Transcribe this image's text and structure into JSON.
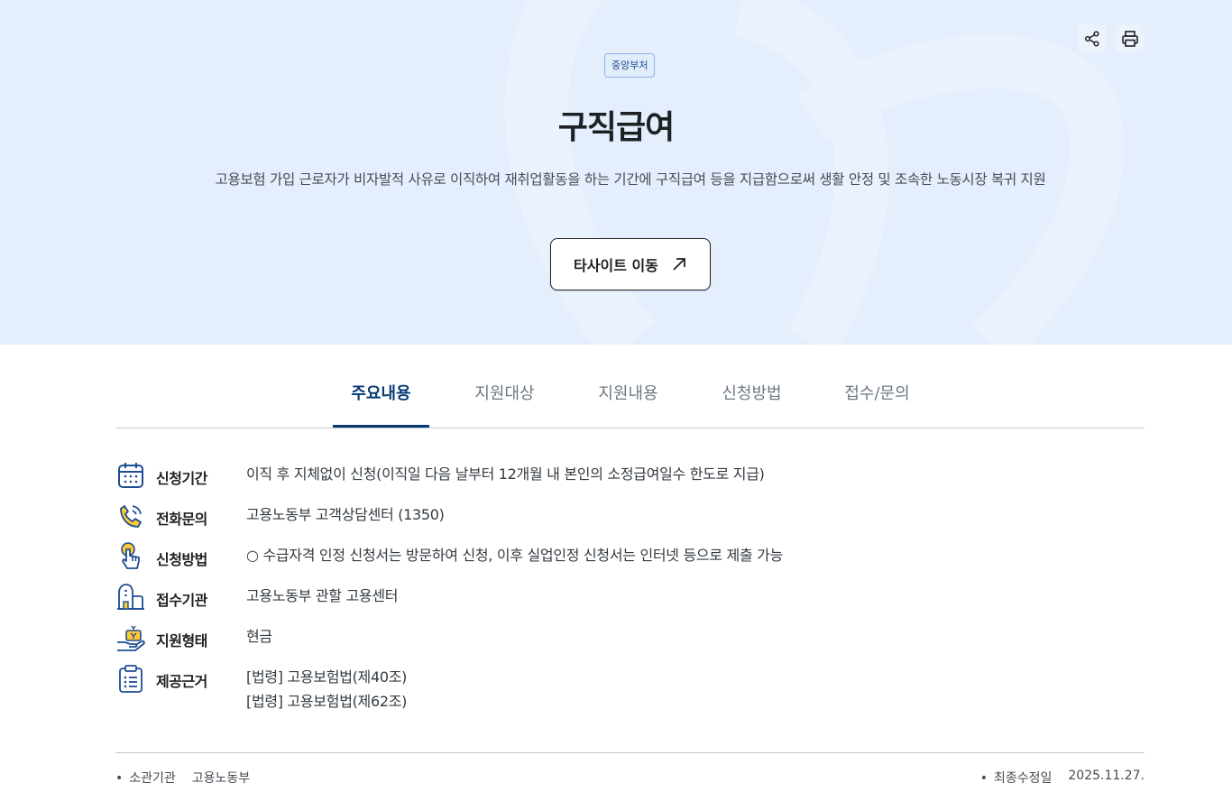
{
  "hero": {
    "badge": "중앙부처",
    "title": "구직급여",
    "description": "고용보험 가입 근로자가 비자발적 사유로 이직하여 재취업활동을 하는 기간에 구직급여 등을 지급함으로써 생활 안정 및 조속한 노동시장 복귀 지원",
    "external_button": "타사이트 이동",
    "tools": {
      "share_icon": "share-icon",
      "print_icon": "print-icon"
    }
  },
  "tabs": [
    {
      "label": "주요내용",
      "active": true
    },
    {
      "label": "지원대상",
      "active": false
    },
    {
      "label": "지원내용",
      "active": false
    },
    {
      "label": "신청방법",
      "active": false
    },
    {
      "label": "접수/문의",
      "active": false
    }
  ],
  "info": [
    {
      "icon": "calendar-icon",
      "label": "신청기간",
      "value": "이직 후 지체없이 신청(이직일 다음 날부터 12개월 내 본인의 소정급여일수 한도로 지급)"
    },
    {
      "icon": "phone-icon",
      "label": "전화문의",
      "value": "고용노동부 고객상담센터 (1350)"
    },
    {
      "icon": "hand-pointer-icon",
      "label": "신청방법",
      "value": "○ 수급자격 인정 신청서는 방문하여 신청, 이후 실업인정 신청서는 인터넷 등으로 제출 가능"
    },
    {
      "icon": "building-icon",
      "label": "접수기관",
      "value": "고용노동부 관할 고용센터"
    },
    {
      "icon": "money-hand-icon",
      "label": "지원형태",
      "value": "현금"
    },
    {
      "icon": "clipboard-list-icon",
      "label": "제공근거",
      "value_lines": [
        "[법령] 고용보험법(제40조)",
        "[법령] 고용보험법(제62조)"
      ]
    }
  ],
  "footer": {
    "org_label": "소관기관",
    "org_value": "고용노동부",
    "updated_label": "최종수정일",
    "updated_value": "2025.11.27."
  },
  "colors": {
    "hero_bg": "#e4eefd",
    "accent": "#063a74",
    "icon_blue": "#1e4d94",
    "icon_yellow": "#ffc933"
  }
}
